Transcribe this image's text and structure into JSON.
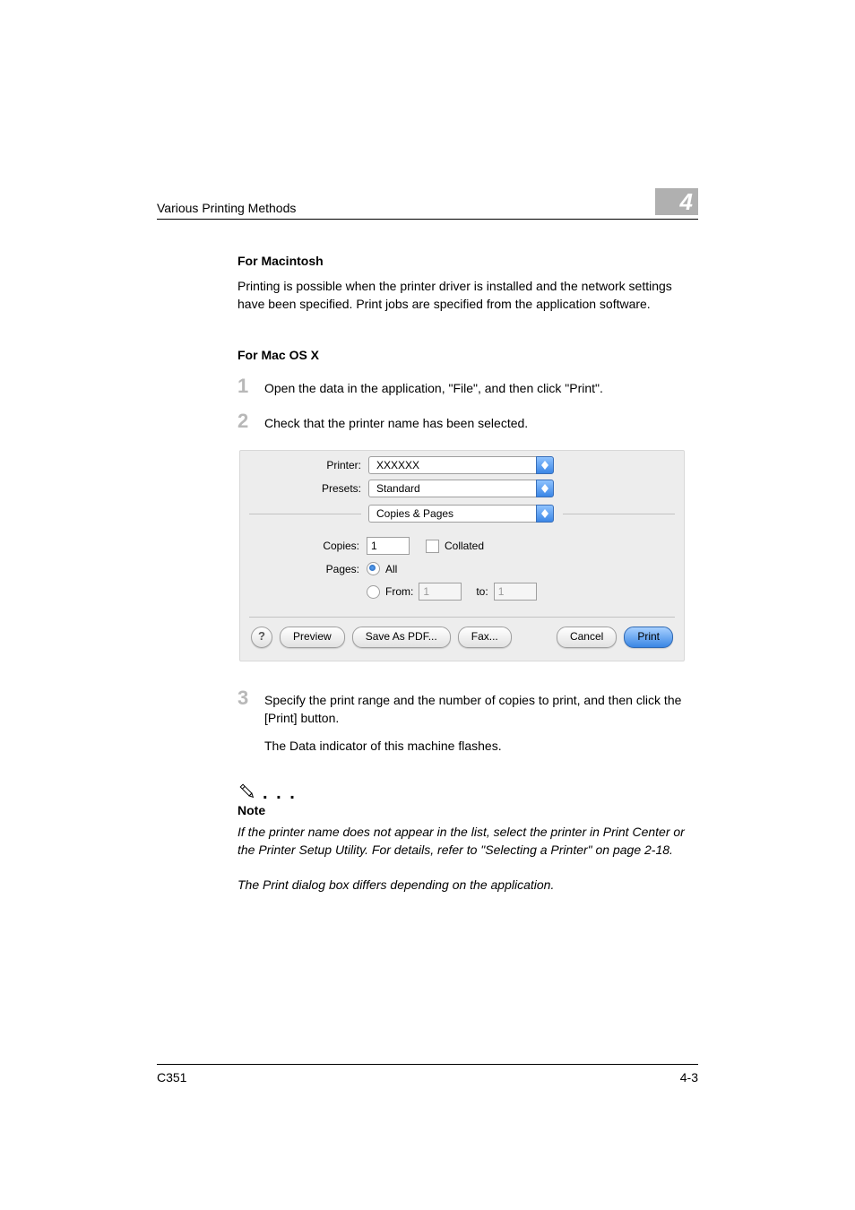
{
  "header": {
    "title": "Various Printing Methods",
    "chapter": "4"
  },
  "sections": {
    "for_mac_heading": "For Macintosh",
    "for_mac_body": "Printing is possible when the printer driver is installed and the network settings have been specified. Print jobs are specified from the application software.",
    "for_osx_heading": "For Mac OS X"
  },
  "steps": {
    "s1_num": "1",
    "s1_text": "Open the data in the application, \"File\", and then click \"Print\".",
    "s2_num": "2",
    "s2_text": "Check that the printer name has been selected.",
    "s3_num": "3",
    "s3_text": "Specify the print range and the number of copies to print, and then click the [Print] button.",
    "s3_sub": "The Data indicator of this machine flashes."
  },
  "dialog": {
    "printer_label": "Printer:",
    "printer_value": "XXXXXX",
    "presets_label": "Presets:",
    "presets_value": "Standard",
    "panel_value": "Copies & Pages",
    "copies_label": "Copies:",
    "copies_value": "1",
    "collated_label": "Collated",
    "pages_label": "Pages:",
    "pages_all_label": "All",
    "pages_from_label": "From:",
    "pages_from_value": "1",
    "pages_to_label": "to:",
    "pages_to_value": "1",
    "help": "?",
    "preview": "Preview",
    "save_pdf": "Save As PDF...",
    "fax": "Fax...",
    "cancel": "Cancel",
    "print": "Print"
  },
  "note": {
    "heading": "Note",
    "body1": "If the printer name does not appear in the list, select the printer in Print Center or the Printer Setup Utility. For details, refer to \"Selecting a Printer\" on page 2-18.",
    "body2": "The Print dialog box differs depending on the application."
  },
  "footer": {
    "model": "C351",
    "page": "4-3"
  }
}
